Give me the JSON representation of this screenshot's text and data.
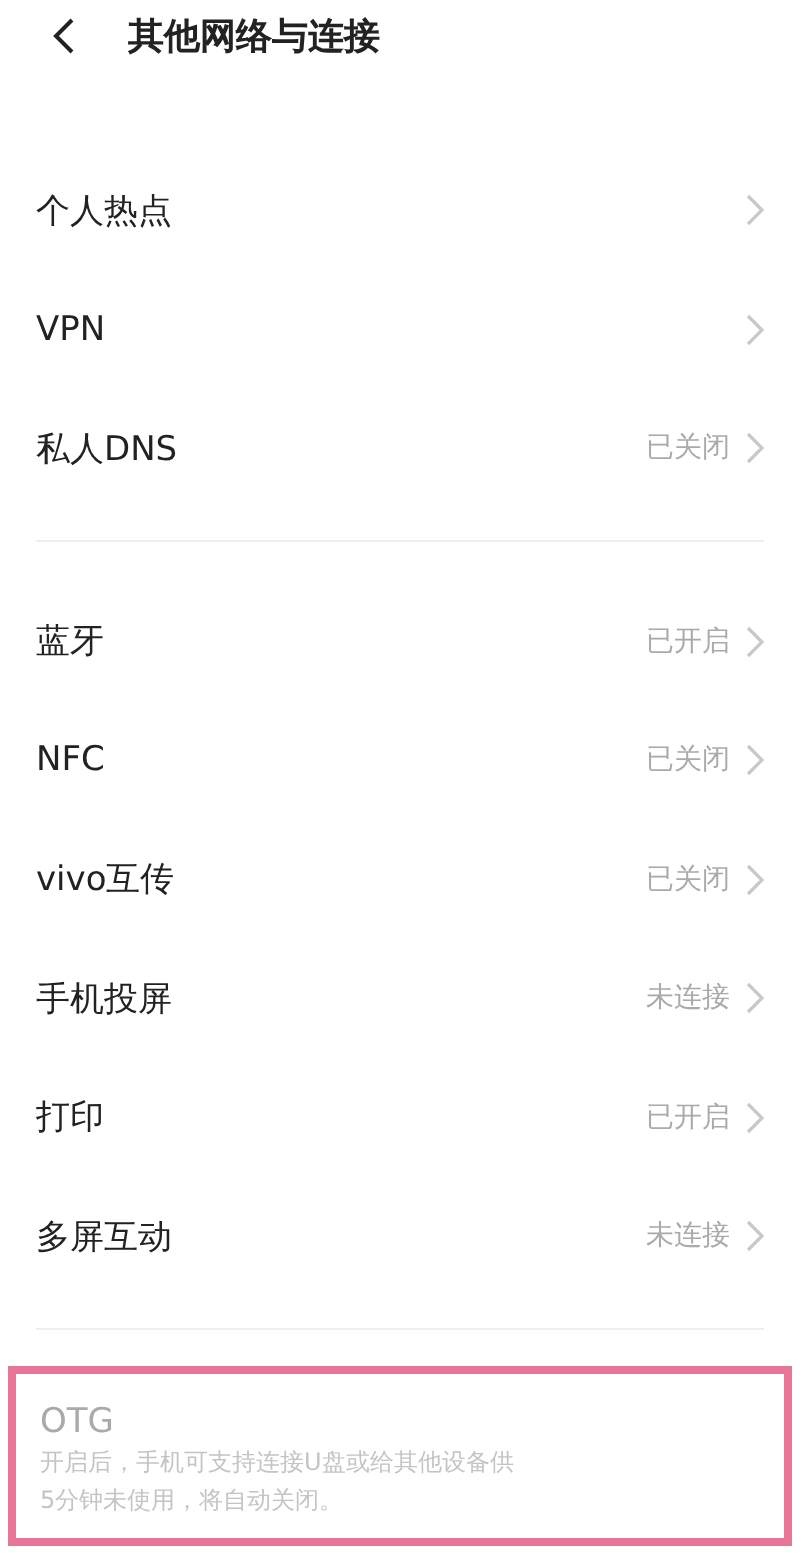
{
  "header": {
    "title": "其他网络与连接"
  },
  "groups": [
    {
      "items": [
        {
          "label": "个人热点"
        },
        {
          "label": "VPN"
        },
        {
          "label": "私人DNS",
          "status": "已关闭"
        }
      ]
    },
    {
      "items": [
        {
          "label": "蓝牙",
          "status": "已开启"
        },
        {
          "label": "NFC",
          "status": "已关闭"
        },
        {
          "label": "vivo互传",
          "status": "已关闭"
        },
        {
          "label": "手机投屏",
          "status": "未连接"
        },
        {
          "label": "打印",
          "status": "已开启"
        },
        {
          "label": "多屏互动",
          "status": "未连接"
        }
      ]
    }
  ],
  "otg": {
    "title": "OTG",
    "description_lines": [
      "开启后，手机可支持连接U盘或给其他设备供",
      "5分钟未使用，将自动关闭。"
    ],
    "disabled": true,
    "highlighted": true
  }
}
